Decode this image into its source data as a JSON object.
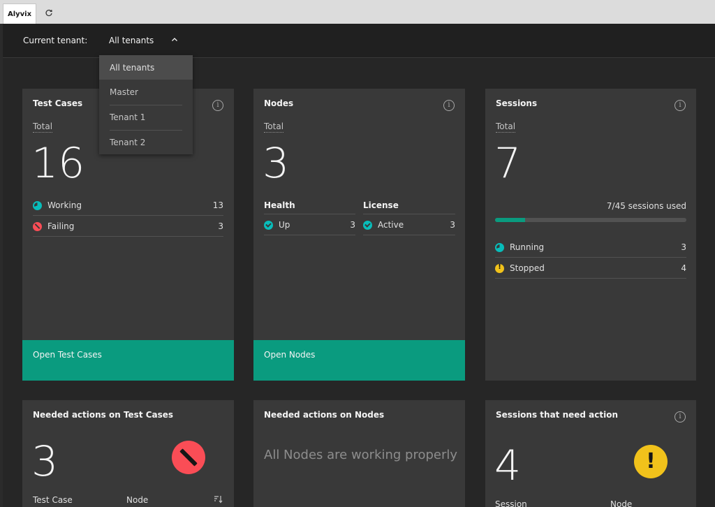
{
  "browser": {
    "tab_title": "Alyvix",
    "reload_icon": "reload-icon"
  },
  "header": {
    "tenant_label": "Current tenant:",
    "tenant_value": "All tenants",
    "chevron_icon": "chevron-up-icon"
  },
  "tenant_dropdown": {
    "options": [
      "All tenants",
      "Master",
      "Tenant 1",
      "Tenant 2"
    ],
    "selected": "All tenants"
  },
  "colors": {
    "accent": "#0a9b7f",
    "working": "#08bdba",
    "failing": "#fa4d56",
    "warning": "#f1c21b",
    "card_bg": "#393939",
    "page_bg": "#262626"
  },
  "cards": {
    "test_cases": {
      "title": "Test Cases",
      "total_label": "Total",
      "total": "16",
      "rows": [
        {
          "label": "Working",
          "value": "13",
          "icon": "working-icon"
        },
        {
          "label": "Failing",
          "value": "3",
          "icon": "failing-icon"
        }
      ],
      "action": "Open Test Cases"
    },
    "nodes": {
      "title": "Nodes",
      "total_label": "Total",
      "total": "3",
      "health_head": "Health",
      "health_rows": [
        {
          "label": "Up",
          "value": "3",
          "icon": "check-icon"
        }
      ],
      "license_head": "License",
      "license_rows": [
        {
          "label": "Active",
          "value": "3",
          "icon": "check-icon"
        }
      ],
      "action": "Open Nodes"
    },
    "sessions": {
      "title": "Sessions",
      "total_label": "Total",
      "total": "7",
      "usage_text": "7/45 sessions used",
      "usage_used": 7,
      "usage_max": 45,
      "rows": [
        {
          "label": "Running",
          "value": "3",
          "icon": "running-icon"
        },
        {
          "label": "Stopped",
          "value": "4",
          "icon": "warning-icon"
        }
      ]
    },
    "needed_test_cases": {
      "title": "Needed actions on Test Cases",
      "count": "3",
      "col1": "Test Case",
      "col2": "Node",
      "sort_icon": "sort-icon"
    },
    "needed_nodes": {
      "title": "Needed actions on Nodes",
      "message": "All Nodes are working properly"
    },
    "sessions_action": {
      "title": "Sessions that need action",
      "count": "4",
      "col1": "Session",
      "col2": "Node"
    }
  }
}
